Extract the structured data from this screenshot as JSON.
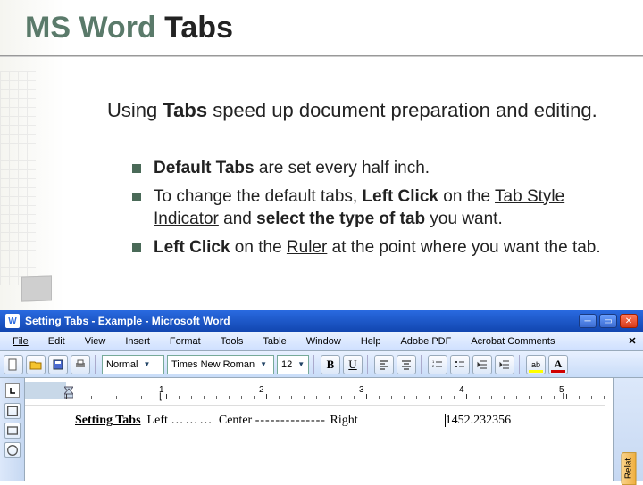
{
  "title": {
    "part1": "MS Word ",
    "part2": "Tabs"
  },
  "intro": {
    "pre": "Using ",
    "bold": "Tabs",
    "post": " speed up document preparation and editing."
  },
  "bullets": [
    {
      "b1": "Default Tabs",
      "t1": " are set every half inch."
    },
    {
      "t0": "To change the default tabs, ",
      "b1": "Left Click",
      "t1": " on the ",
      "u1": "Tab Style Indicator",
      "t2": " and ",
      "b2": "select the type of tab",
      "t3": " you want."
    },
    {
      "b1": "Left Click",
      "t1": " on the ",
      "u1": "Ruler",
      "t2": " at the point where you want the tab."
    }
  ],
  "word": {
    "windowTitle": "Setting Tabs - Example - Microsoft Word",
    "menus": [
      "File",
      "Edit",
      "View",
      "Insert",
      "Format",
      "Tools",
      "Table",
      "Window",
      "Help",
      "Adobe PDF",
      "Acrobat Comments"
    ],
    "style": "Normal",
    "font": "Times New Roman",
    "size": "12",
    "toolbarIcons": {
      "new": "new-icon",
      "open": "open-icon",
      "save": "save-icon",
      "print": "print-icon",
      "bold": "B",
      "under": "U",
      "alignL": "align-left-icon",
      "alignC": "align-center-icon",
      "listN": "numbered-list-icon",
      "listB": "bulleted-list-icon",
      "indentL": "decrease-indent-icon",
      "indentR": "increase-indent-icon",
      "highlight": "ab",
      "fontcolor": "A"
    },
    "ruler": {
      "numbers": [
        "1",
        "2",
        "3",
        "4",
        "5"
      ]
    },
    "line": {
      "label": "Setting Tabs",
      "left": "Left",
      "center": "Center",
      "right": "Right",
      "number": "1452.232356"
    },
    "sidepane": "Relat"
  }
}
